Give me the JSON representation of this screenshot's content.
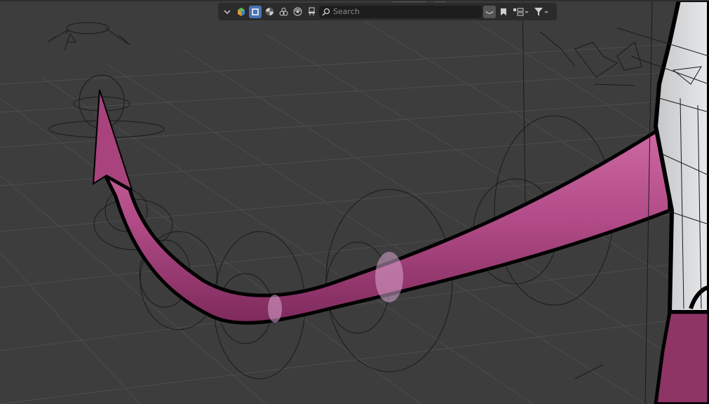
{
  "search": {
    "placeholder": "Search"
  },
  "icons": {
    "collapse": "chevron-down-icon",
    "blender": "blender-logo-icon",
    "object": "object-mode-icon",
    "material": "material-icon",
    "particles": "particles-icon",
    "world": "world-icon",
    "paint": "paint-icon",
    "search": "search-icon",
    "filter": "filter-icon"
  },
  "colors": {
    "accent": "#4772b3",
    "tail": "#b04a86",
    "background": "#3d3d3d"
  }
}
